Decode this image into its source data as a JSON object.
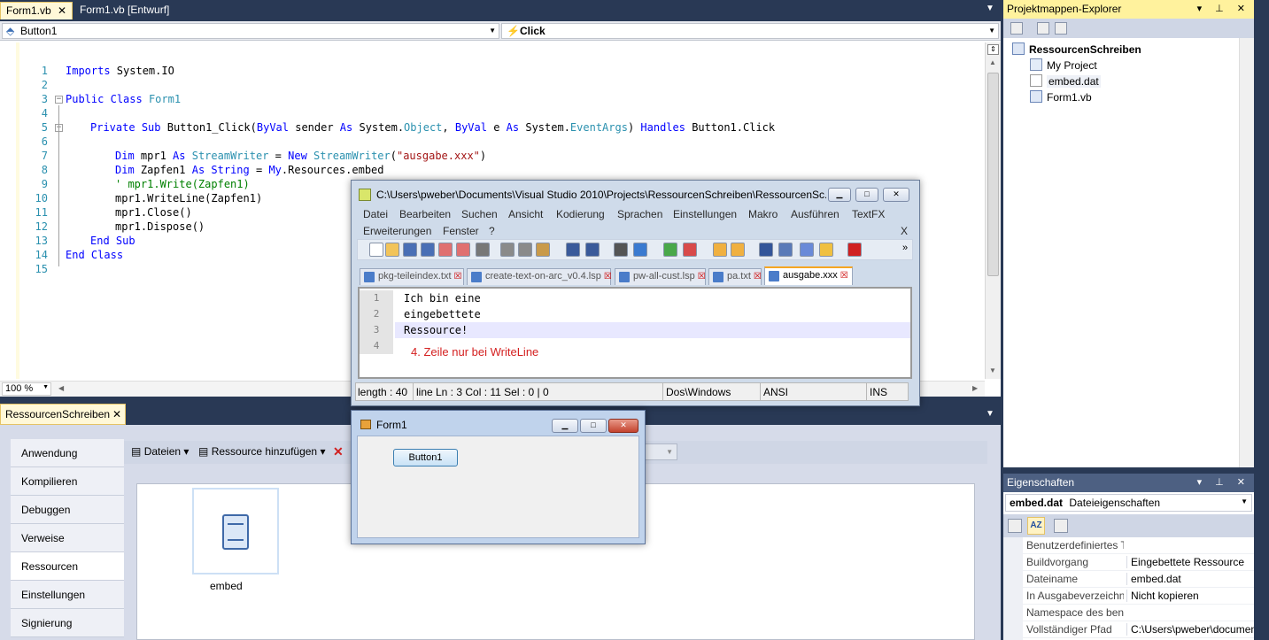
{
  "doc_tabs": [
    "Form1.vb",
    "Form1.vb [Entwurf]"
  ],
  "nav": {
    "object": "Button1",
    "event": "Click"
  },
  "code_lines": [
    {
      "n": "1"
    },
    {
      "n": "2"
    },
    {
      "n": "3"
    },
    {
      "n": "4"
    },
    {
      "n": "5"
    },
    {
      "n": "6"
    },
    {
      "n": "7"
    },
    {
      "n": "8"
    },
    {
      "n": "9"
    },
    {
      "n": "10"
    },
    {
      "n": "11"
    },
    {
      "n": "12"
    },
    {
      "n": "13"
    },
    {
      "n": "14"
    },
    {
      "n": "15"
    }
  ],
  "code": {
    "l1": [
      "Imports",
      " System.IO"
    ],
    "l3": [
      "Public",
      " ",
      "Class",
      " ",
      "Form1"
    ],
    "l5": [
      "Private",
      " ",
      "Sub",
      " Button1_Click(",
      "ByVal",
      " sender ",
      "As",
      " System.",
      "Object",
      ", ",
      "ByVal",
      " e ",
      "As",
      " System.",
      "EventArgs",
      ") ",
      "Handles",
      " Button1.Click"
    ],
    "l7": [
      "Dim",
      " mpr1 ",
      "As",
      " ",
      "StreamWriter",
      " = ",
      "New",
      " ",
      "StreamWriter",
      "(",
      "\"ausgabe.xxx\"",
      ")"
    ],
    "l8": [
      "Dim",
      " Zapfen1 ",
      "As",
      " ",
      "String",
      " = ",
      "My",
      ".Resources.embed"
    ],
    "l9": "' mpr1.Write(Zapfen1)",
    "l10": "mpr1.WriteLine(Zapfen1)",
    "l11": "mpr1.Close()",
    "l12": "mpr1.Dispose()",
    "l13": [
      "End",
      " ",
      "Sub"
    ],
    "l14": [
      "End",
      " ",
      "Class"
    ]
  },
  "zoom": "100 %",
  "solution_explorer": {
    "title": "Projektmappen-Explorer",
    "project": "RessourcenSchreiben",
    "items": [
      "My Project",
      "embed.dat",
      "Form1.vb"
    ]
  },
  "properties": {
    "title": "Eigenschaften",
    "object_name": "embed.dat",
    "object_type": "Dateieigenschaften",
    "rows": [
      {
        "name": "Benutzerdefiniertes T",
        "value": ""
      },
      {
        "name": "Buildvorgang",
        "value": "Eingebettete Ressource"
      },
      {
        "name": "Dateiname",
        "value": "embed.dat"
      },
      {
        "name": "In Ausgabeverzeichn",
        "value": "Nicht kopieren"
      },
      {
        "name": "Namespace des benu",
        "value": ""
      },
      {
        "name": "Vollständiger Pfad",
        "value": "C:\\Users\\pweber\\documents"
      }
    ]
  },
  "resources": {
    "tab": "RessourcenSchreiben",
    "side": [
      "Anwendung",
      "Kompilieren",
      "Debuggen",
      "Verweise",
      "Ressourcen",
      "Einstellungen",
      "Signierung"
    ],
    "toolbar": {
      "files": "Dateien",
      "add": "Ressource hinzufügen"
    },
    "item_label": "embed"
  },
  "npp": {
    "title": "C:\\Users\\pweber\\Documents\\Visual Studio 2010\\Projects\\RessourcenSchreiben\\RessourcenSc...",
    "menu1": [
      "Datei",
      "Bearbeiten",
      "Suchen",
      "Ansicht",
      "Kodierung",
      "Sprachen",
      "Einstellungen",
      "Makro",
      "Ausführen",
      "TextFX"
    ],
    "menu2": [
      "Erweiterungen",
      "Fenster",
      "?"
    ],
    "menu_close": "X",
    "tabs": [
      "pkg-teileindex.txt",
      "create-text-on-arc_v0.4.lsp",
      "pw-all-cust.lsp",
      "pa.txt",
      "ausgabe.xxx"
    ],
    "lines": [
      {
        "n": "1",
        "text": "Ich bin eine"
      },
      {
        "n": "2",
        "text": "eingebettete"
      },
      {
        "n": "3",
        "text": "Ressource!"
      },
      {
        "n": "4",
        "text": ""
      }
    ],
    "annotation": "4. Zeile nur bei WriteLine",
    "status": {
      "length": "length : 40",
      "lines": "line",
      "pos": "Ln : 3    Col : 11    Sel : 0 | 0",
      "eol": "Dos\\Windows",
      "enc": "ANSI",
      "mode": "INS"
    },
    "colors": {
      "annotation": "#d42020",
      "current_line": "#e8e8ff"
    }
  },
  "form1": {
    "title": "Form1",
    "button": "Button1"
  }
}
